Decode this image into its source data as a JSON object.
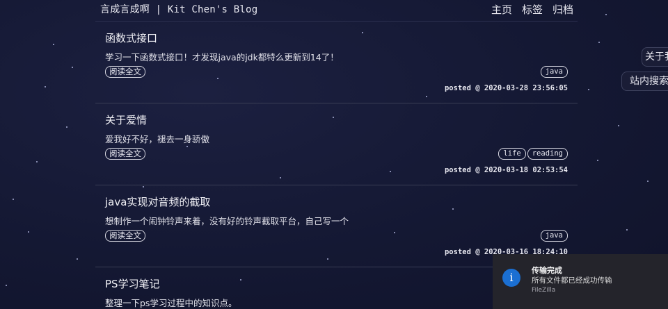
{
  "header": {
    "site_title": "言成言成啊 | Kit Chen's Blog",
    "nav": [
      "主页",
      "标签",
      "归档"
    ]
  },
  "posts": [
    {
      "title": "函数式接口",
      "summary": "学习一下函数式接口！才发现java的jdk都特么更新到14了！",
      "read_more": "阅读全文",
      "tags": [
        "java"
      ],
      "posted": "posted @ 2020-03-28 23:56:05"
    },
    {
      "title": "关于爱情",
      "summary": "爱我好不好，褪去一身骄傲",
      "read_more": "阅读全文",
      "tags": [
        "life",
        "reading"
      ],
      "posted": "posted @ 2020-03-18 02:53:54"
    },
    {
      "title": "java实现对音频的截取",
      "summary": "想制作一个闹钟铃声来着，没有好的铃声截取平台，自己写一个",
      "read_more": "阅读全文",
      "tags": [
        "java"
      ],
      "posted": "posted @ 2020-03-16 18:24:10"
    },
    {
      "title": "PS学习笔记",
      "summary": "整理一下ps学习过程中的知识点。"
    }
  ],
  "side": {
    "about": "关于我",
    "search": "站内搜索"
  },
  "toast": {
    "icon": "info-icon",
    "icon_glyph": "i",
    "title": "传输完成",
    "message": "所有文件都已经成功传输",
    "app": "FileZilla",
    "accent": "#1b6fd2"
  },
  "colors": {
    "background": "#161a33",
    "text": "#e8e8f0"
  }
}
